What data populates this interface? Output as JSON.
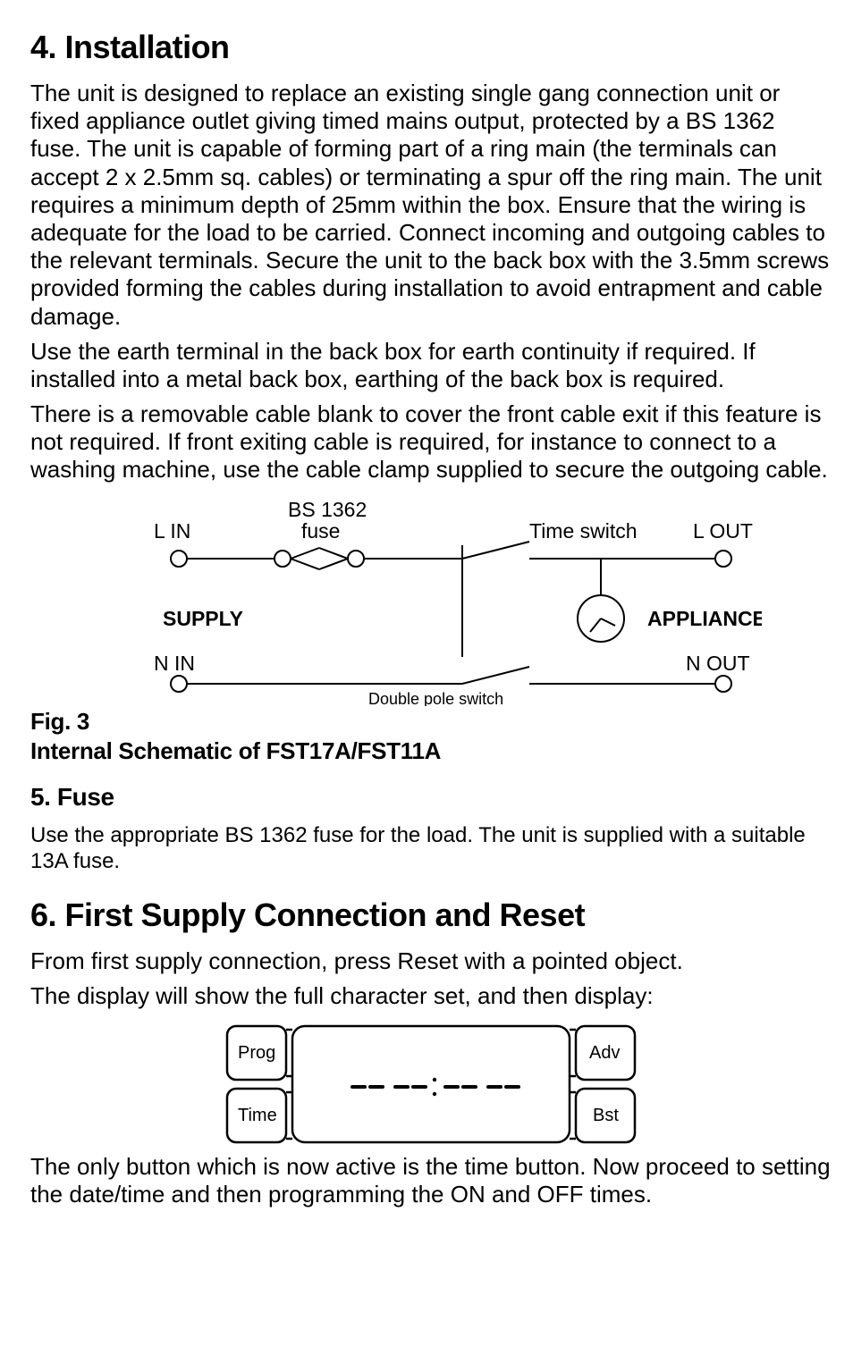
{
  "s4": {
    "heading": "4. Installation",
    "p1": "The unit is designed to replace an existing single gang connection unit or fixed appliance outlet giving timed mains output, protected by a BS 1362 fuse. The unit is capable of forming part of a ring main (the terminals can accept 2 x 2.5mm sq. cables) or terminating a spur off the ring main. The unit requires a minimum depth of 25mm within the box. Ensure that the wiring is adequate for the load to be carried. Connect incoming and outgoing cables to the relevant terminals. Secure the unit to the back box with the 3.5mm screws provided forming the cables during installation to avoid entrapment and cable damage.",
    "p2": "Use the earth terminal in the back box for earth continuity if required. If installed into a metal back box, earthing of the back box is required.",
    "p3": "There is a removable cable blank to cover the front cable exit if this feature is not required. If front exiting cable is required, for instance to connect to a washing machine, use the cable clamp supplied to secure the outgoing cable."
  },
  "schematic": {
    "l_in": "L IN",
    "n_in": "N IN",
    "l_out": "L OUT",
    "n_out": "N OUT",
    "fuse_line1": "BS 1362",
    "fuse_line2": "fuse",
    "time_switch": "Time switch",
    "supply": "SUPPLY",
    "appliance": "APPLIANCE",
    "dp_switch": "Double pole switch",
    "fig_label": "Fig. 3",
    "title": "Internal Schematic of FST17A/FST11A"
  },
  "s5": {
    "heading": "5. Fuse",
    "p1": "Use the appropriate BS 1362 fuse for the load. The unit is supplied with a suitable 13A fuse."
  },
  "s6": {
    "heading": "6. First Supply Connection and Reset",
    "p1": "From first supply connection, press Reset with a pointed object.",
    "p2": "The display will show the full character set, and then display:",
    "p3": "The only button which is now active is the time button. Now proceed to setting the date/time and then programming the ON and OFF times."
  },
  "lcd": {
    "prog": "Prog",
    "time": "Time",
    "adv": "Adv",
    "bst": "Bst",
    "digits": "-- -- : -- --"
  }
}
